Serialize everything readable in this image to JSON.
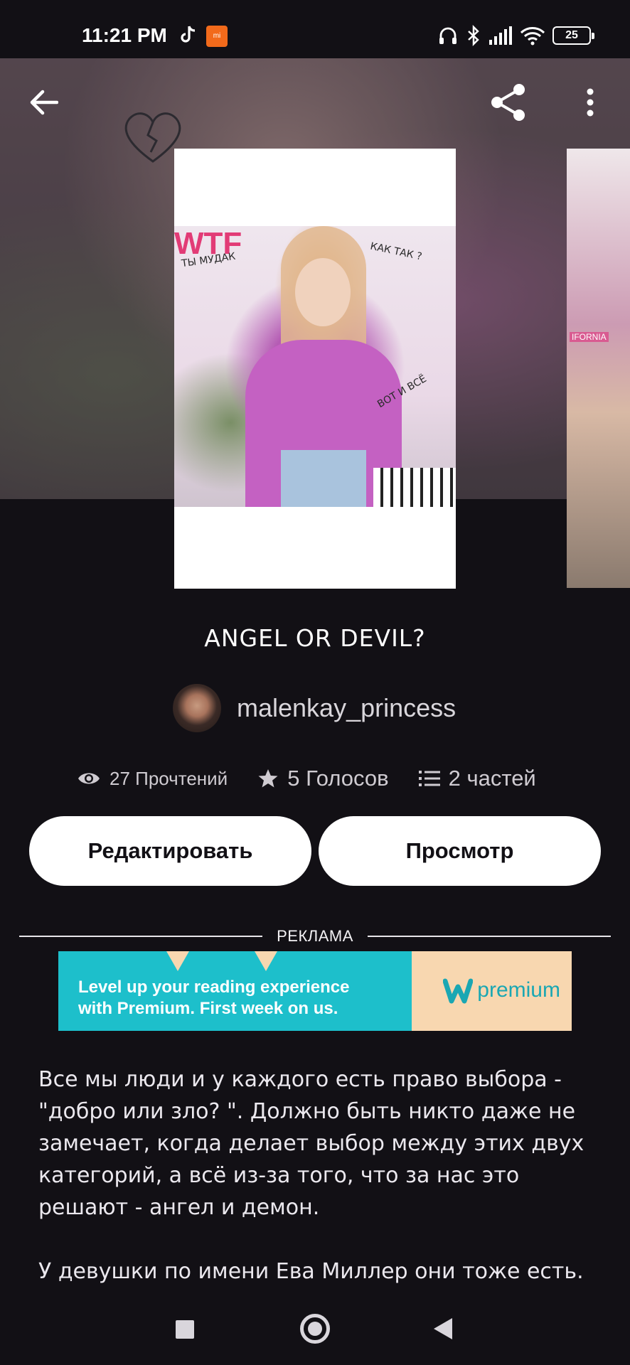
{
  "status_bar": {
    "time": "11:21 PM",
    "battery": "25",
    "icons": [
      "tiktok-icon",
      "mi-app-icon",
      "headset-icon",
      "bluetooth-icon",
      "signal-icon",
      "wifi-icon",
      "battery-icon"
    ]
  },
  "header": {
    "back_icon": "arrow-left-icon",
    "share_icon": "share-icon",
    "more_icon": "more-vertical-icon"
  },
  "cover": {
    "texts": [
      "WTF",
      "ТЫ МУДАК",
      "КАК ТАК ?",
      "ВОТ И ВСЁ"
    ],
    "peek_label": "IFORNIA"
  },
  "story": {
    "title": "ANGEL OR DEVIL?",
    "author": "malenkay_princess",
    "reads": "27 Прочтений",
    "votes": "5 Голосов",
    "parts": "2 частей"
  },
  "actions": {
    "edit_label": "Редактировать",
    "view_label": "Просмотр"
  },
  "ad": {
    "label": "РЕКЛАМА",
    "line1": "Level up your reading experience",
    "line2": "with Premium. First week on us.",
    "brand": "premium"
  },
  "description": {
    "paragraph1": "Все мы люди и у каждого есть право выбора - \"добро или зло? \". Должно быть никто даже не замечает, когда делает выбор между этих двух категорий, а всё из-за того, что за нас это решают - ангел и демон.",
    "paragraph2": "У девушки по имени Ева Миллер они тоже есть."
  },
  "nav": {
    "icons": [
      "recent-apps-icon",
      "home-icon",
      "back-icon"
    ]
  },
  "colors": {
    "background": "#121015",
    "button": "#ffffff",
    "ad_teal": "#1dbfcb",
    "ad_peach": "#f8d7b0"
  }
}
